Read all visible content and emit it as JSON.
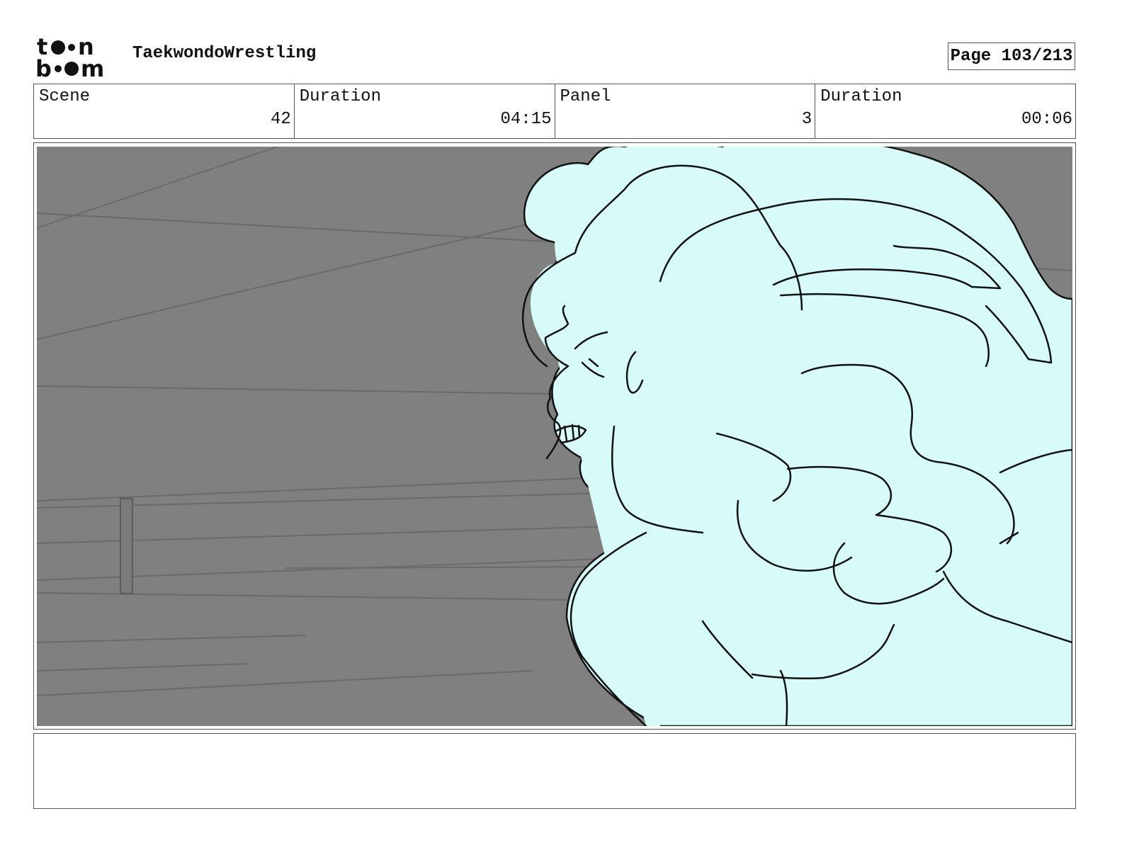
{
  "header": {
    "logo_top": "to•n",
    "logo_bottom": "b••m",
    "project_title": "TaekwondoWrestling",
    "page_label": "Page 103/213"
  },
  "info": {
    "scene_label": "Scene",
    "scene_value": "42",
    "scene_duration_label": "Duration",
    "scene_duration_value": "04:15",
    "panel_label": "Panel",
    "panel_value": "3",
    "panel_duration_label": "Duration",
    "panel_duration_value": "00:06"
  },
  "panel": {
    "background_color": "#808080",
    "character_fill": "#d6fbf8"
  },
  "notes": {
    "text": ""
  }
}
